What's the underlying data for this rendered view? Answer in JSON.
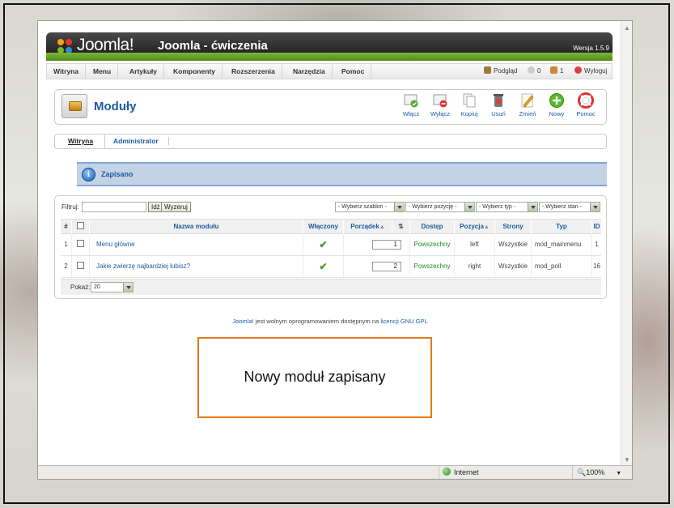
{
  "header": {
    "logo_text": "Joomla!",
    "site_title": "Joomla - ćwiczenia",
    "version": "Wersja 1.5.9"
  },
  "menu": {
    "items": [
      "Witryna",
      "Menu",
      "Artykuły",
      "Komponenty",
      "Rozszerzenia",
      "Narzędzia",
      "Pomoc"
    ],
    "right": {
      "preview": "Podgląd",
      "messages": "0",
      "users": "1",
      "logout": "Wyloguj"
    }
  },
  "toolbar": {
    "title": "Moduły",
    "buttons": [
      {
        "label": "Włącz",
        "icon": "publish-icon"
      },
      {
        "label": "Wyłącz",
        "icon": "unpublish-icon"
      },
      {
        "label": "Kopiuj",
        "icon": "copy-icon"
      },
      {
        "label": "Usuń",
        "icon": "delete-icon"
      },
      {
        "label": "Zmień",
        "icon": "edit-icon"
      },
      {
        "label": "Nowy",
        "icon": "new-icon"
      },
      {
        "label": "Pomoc",
        "icon": "help-icon"
      }
    ]
  },
  "submenu": {
    "items": [
      "Witryna",
      "Administrator"
    ]
  },
  "message": {
    "text": "Zapisano"
  },
  "filter": {
    "label": "Filtruj:",
    "input_value": "",
    "go_button": "Idź",
    "reset_button": "Wyzeruj",
    "selects": [
      "- Wybierz szablon -",
      "- Wybierz pozycję -",
      "- Wybierz typ -",
      "- Wybierz stan -"
    ]
  },
  "table": {
    "columns": [
      "#",
      "",
      "Nazwa modułu",
      "Włączony",
      "Porządek",
      "",
      "Dostęp",
      "Pozycja",
      "Strony",
      "Typ",
      "ID"
    ],
    "rows": [
      {
        "num": "1",
        "name": "Menu główne",
        "order": "1",
        "access": "Powszechny",
        "position": "left",
        "pages": "Wszystkie",
        "type": "mod_mainmenu",
        "id": "1"
      },
      {
        "num": "2",
        "name": "Jakie zwierzę najbardziej lubisz?",
        "order": "2",
        "access": "Powszechny",
        "position": "right",
        "pages": "Wszystkie",
        "type": "mod_poll",
        "id": "16"
      }
    ],
    "display_label": "Pokaż:",
    "display_value": "20"
  },
  "footer": {
    "link1": "Joomla!",
    "text": " jest wolnym oprogramowaniem dostępnym na ",
    "link2": "licencji GNU GPL"
  },
  "statusbar": {
    "zone": "Internet",
    "zoom": "100%"
  },
  "annotation": {
    "text": "Nowy moduł zapisany"
  },
  "colors": {
    "accent_blue": "#1e5b9e",
    "joomla_green": "#6aa52a",
    "annotation_border": "#e07a1c"
  }
}
